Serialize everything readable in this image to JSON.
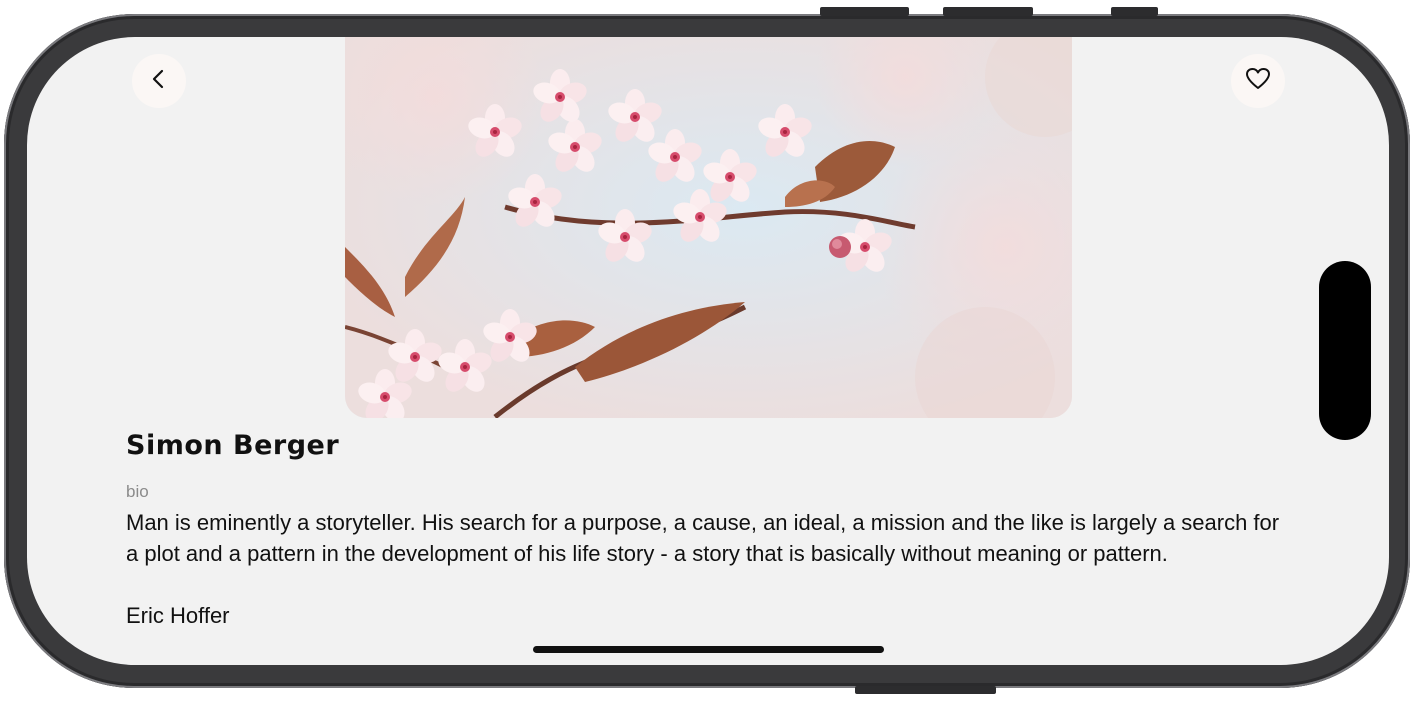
{
  "profile": {
    "name": "Simon Berger",
    "bio_label": "bio",
    "bio_text": "Man is eminently a storyteller. His search for a purpose, a cause, an ideal, a mission and the like is largely a search for a plot and a pattern in the development of his life story - a story that is basically without meaning or pattern.",
    "bio_author": "Eric Hoffer"
  },
  "header": {
    "back_icon": "chevron-left-icon",
    "favorite_icon": "heart-outline-icon"
  },
  "hero": {
    "subject": "pink cherry blossom branch"
  },
  "colors": {
    "screen_background": "#f2f2f2",
    "button_background": "#fbf7f5",
    "text_primary": "#111111",
    "text_secondary": "#8b8b8b"
  }
}
